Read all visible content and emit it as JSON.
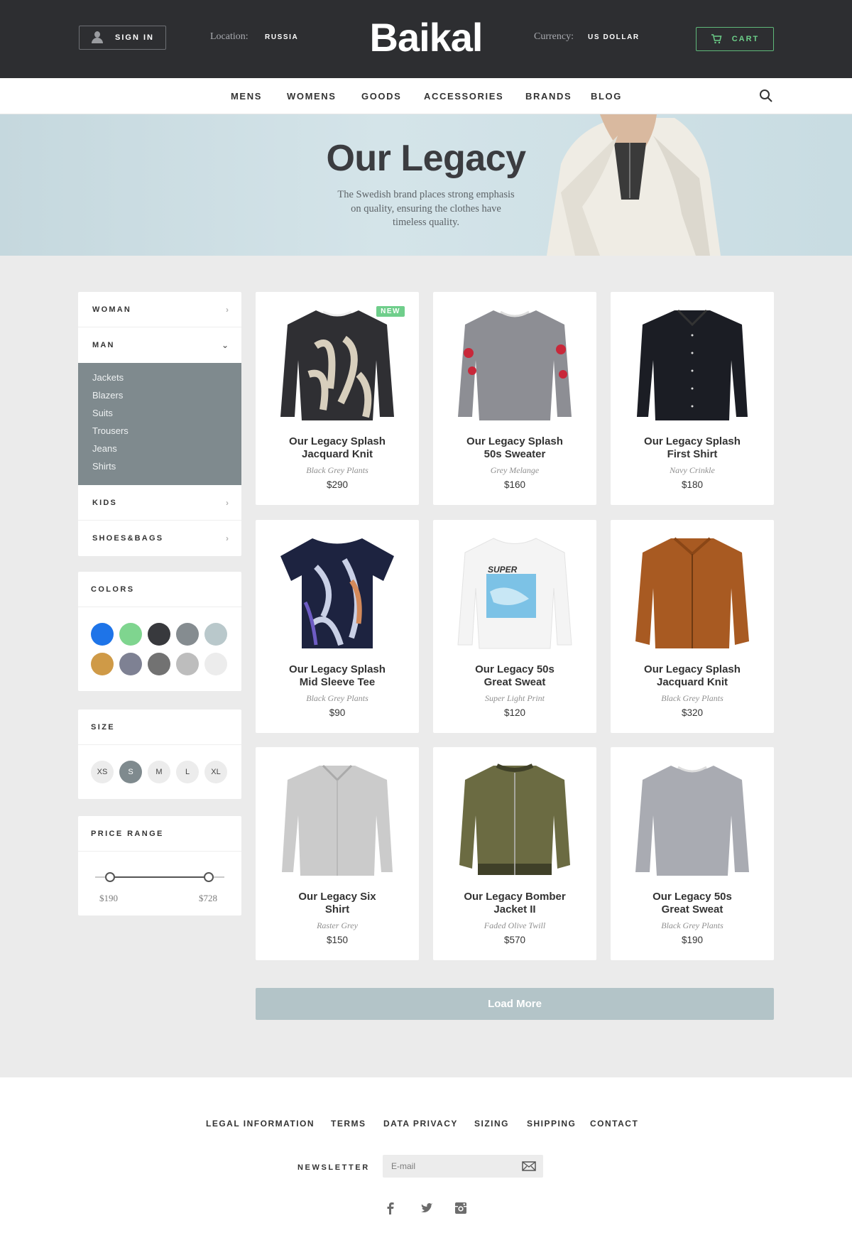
{
  "header": {
    "signin_label": "SIGN IN",
    "location_label": "Location:",
    "location_value": "RUSSIA",
    "logo": "Baikal",
    "currency_label": "Currency:",
    "currency_value": "US DOLLAR",
    "cart_label": "CART",
    "accent_color": "#6ccf89"
  },
  "nav": {
    "items": [
      "MENS",
      "WOMENS",
      "GOODS",
      "ACCESSORIES",
      "BRANDS",
      "BLOG"
    ],
    "search_icon": "search-icon"
  },
  "hero": {
    "title": "Our Legacy",
    "subtitle_lines": [
      "The Swedish brand places strong emphasis",
      "on quality, ensuring the clothes have",
      "timeless quality."
    ]
  },
  "sidebar": {
    "categories": [
      {
        "label": "WOMAN",
        "icon": "chevron-right-icon",
        "expanded": false
      },
      {
        "label": "MAN",
        "icon": "chevron-down-icon",
        "expanded": true
      },
      {
        "label": "KIDS",
        "icon": "chevron-right-icon",
        "expanded": false
      },
      {
        "label": "SHOES&BAGS",
        "icon": "chevron-right-icon",
        "expanded": false
      }
    ],
    "man_subcategories": [
      "Jackets",
      "Blazers",
      "Suits",
      "Trousers",
      "Jeans",
      "Shirts"
    ],
    "colors_title": "COLORS",
    "colors": [
      "#1e74e8",
      "#7fd58f",
      "#38393d",
      "#858c90",
      "#b9c8cb",
      "#cf9a47",
      "#7e8193",
      "#727272",
      "#bdbdbd",
      "#ececec"
    ],
    "size_title": "SIZE",
    "sizes": [
      "XS",
      "S",
      "M",
      "L",
      "XL"
    ],
    "selected_size": "S",
    "price_title": "PRICE RANGE",
    "price_min": "$190",
    "price_max": "$728"
  },
  "products": [
    {
      "name1": "Our Legacy Splash",
      "name2": "Jacquard Knit",
      "variant": "Black Grey Plants",
      "price": "$290",
      "badge": "NEW"
    },
    {
      "name1": "Our Legacy Splash",
      "name2": "50s Sweater",
      "variant": "Grey Melange",
      "price": "$160"
    },
    {
      "name1": "Our Legacy Splash",
      "name2": "First Shirt",
      "variant": "Navy Crinkle",
      "price": "$180"
    },
    {
      "name1": "Our Legacy Splash",
      "name2": "Mid Sleeve Tee",
      "variant": "Black Grey Plants",
      "price": "$90"
    },
    {
      "name1": "Our Legacy 50s",
      "name2": "Great Sweat",
      "variant": "Super Light Print",
      "price": "$120"
    },
    {
      "name1": "Our Legacy Splash",
      "name2": "Jacquard Knit",
      "variant": "Black Grey Plants",
      "price": "$320"
    },
    {
      "name1": "Our Legacy Six",
      "name2": "Shirt",
      "variant": "Raster Grey",
      "price": "$150"
    },
    {
      "name1": "Our Legacy Bomber",
      "name2": "Jacket II",
      "variant": "Faded Olive Twill",
      "price": "$570"
    },
    {
      "name1": "Our Legacy 50s",
      "name2": "Great Sweat",
      "variant": "Black Grey Plants",
      "price": "$190"
    }
  ],
  "load_more": "Load More",
  "footer": {
    "links": [
      "LEGAL INFORMATION",
      "TERMS",
      "DATA PRIVACY",
      "SIZING",
      "SHIPPING",
      "CONTACT"
    ],
    "newsletter_label": "NEWSLETTER",
    "email_placeholder": "E-mail",
    "social_icons": [
      "facebook-icon",
      "twitter-icon",
      "instagram-icon"
    ]
  }
}
